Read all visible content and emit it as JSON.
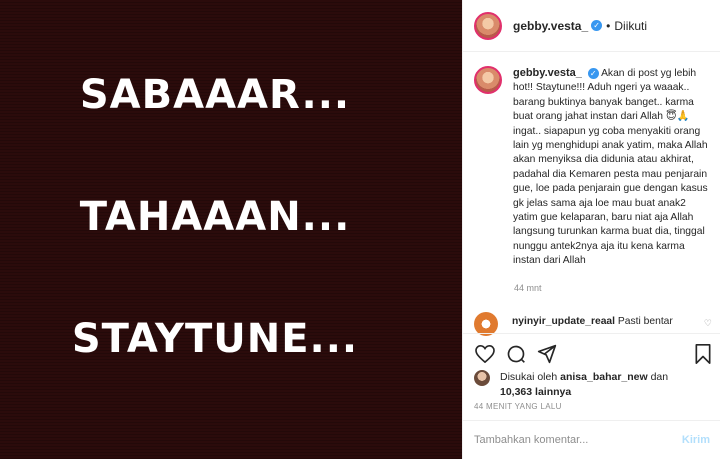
{
  "post": {
    "lines": [
      "SABAAAR...",
      "TAHAAAN...",
      "STAYTUNE..."
    ]
  },
  "header": {
    "username": "gebby.vesta_",
    "separator": "•",
    "follow_label": "Diikuti"
  },
  "caption": {
    "username": "gebby.vesta_",
    "text": "Akan di post yg lebih hot!! Staytune!!! Aduh ngeri ya waaak.. barang buktinya banyak banget.. karma buat orang jahat instan dari Allah 😇🙏 ingat.. siapapun yg coba menyakiti orang lain yg menghidupi anak yatim, maka Allah akan menyiksa dia didunia atau akhirat, padahal dia Kemaren pesta mau penjarain gue, loe pada penjarain gue dengan kasus gk jelas sama aja loe mau buat anak2 yatim gue kelaparan, baru niat aja Allah langsung turunkan karma buat dia, tinggal nunggu antek2nya aja itu kena karma instan dari Allah",
    "time": "44 mnt"
  },
  "comment": {
    "username": "nyinyir_update_reaal",
    "text": "Pasti bentar"
  },
  "likes": {
    "prefix": "Disukai oleh",
    "liker": "anisa_bahar_new",
    "connector": "dan",
    "count": "10,363 lainnya"
  },
  "timestamp": "44 MENIT YANG LALU",
  "comment_box": {
    "placeholder": "Tambahkan komentar...",
    "post_label": "Kirim"
  },
  "colors": {
    "verified": "#3897f0",
    "post_button": "#b2dffc",
    "image_bg": "#2b0b0b"
  }
}
